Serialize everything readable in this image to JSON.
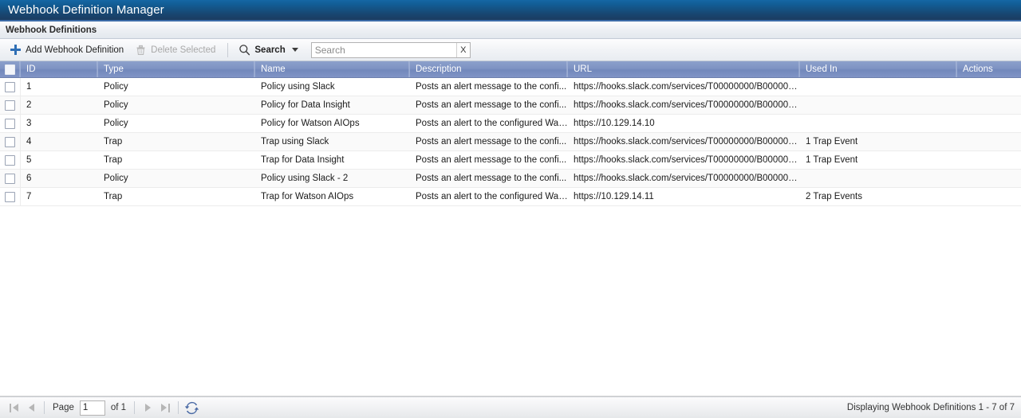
{
  "window": {
    "title": "Webhook Definition Manager"
  },
  "section": {
    "title": "Webhook Definitions"
  },
  "toolbar": {
    "add_label": "Add Webhook Definition",
    "add_icon": "plus-icon",
    "delete_label": "Delete Selected",
    "delete_icon": "trash-icon",
    "search_label": "Search",
    "search_icon": "magnifier-icon",
    "search_caret_icon": "chevron-down-icon",
    "search_value": "",
    "search_placeholder": "Search",
    "search_clear_label": "X"
  },
  "grid": {
    "columns": [
      {
        "key": "checkbox",
        "label": ""
      },
      {
        "key": "id",
        "label": "ID"
      },
      {
        "key": "type",
        "label": "Type"
      },
      {
        "key": "name",
        "label": "Name"
      },
      {
        "key": "description",
        "label": "Description"
      },
      {
        "key": "url",
        "label": "URL"
      },
      {
        "key": "used_in",
        "label": "Used In"
      },
      {
        "key": "actions",
        "label": "Actions"
      }
    ],
    "rows": [
      {
        "id": "1",
        "type": "Policy",
        "name": "Policy using Slack",
        "description": "Posts an alert message to the confi...",
        "url": "https://hooks.slack.com/services/T00000000/B0000000...",
        "used_in": "",
        "actions": ""
      },
      {
        "id": "2",
        "type": "Policy",
        "name": "Policy for Data Insight",
        "description": "Posts an alert message to the confi...",
        "url": "https://hooks.slack.com/services/T00000000/B0000000...",
        "used_in": "",
        "actions": ""
      },
      {
        "id": "3",
        "type": "Policy",
        "name": "Policy for Watson AIOps",
        "description": "Posts an alert to the configured Wat...",
        "url": "https://10.129.14.10",
        "used_in": "",
        "actions": ""
      },
      {
        "id": "4",
        "type": "Trap",
        "name": "Trap using Slack",
        "description": "Posts an alert message to the confi...",
        "url": "https://hooks.slack.com/services/T00000000/B0000000...",
        "used_in": "1 Trap Event",
        "actions": ""
      },
      {
        "id": "5",
        "type": "Trap",
        "name": "Trap for Data Insight",
        "description": "Posts an alert message to the confi...",
        "url": "https://hooks.slack.com/services/T00000000/B0000000...",
        "used_in": "1 Trap Event",
        "actions": ""
      },
      {
        "id": "6",
        "type": "Policy",
        "name": "Policy using Slack - 2",
        "description": "Posts an alert message to the confi...",
        "url": "https://hooks.slack.com/services/T00000000/B0000000...",
        "used_in": "",
        "actions": ""
      },
      {
        "id": "7",
        "type": "Trap",
        "name": "Trap for Watson AIOps",
        "description": "Posts an alert to the configured Wat...",
        "url": "https://10.129.14.11",
        "used_in": "2 Trap Events",
        "actions": ""
      }
    ]
  },
  "pager": {
    "first_icon": "first-page-icon",
    "prev_icon": "previous-page-icon",
    "page_label": "Page",
    "page_value": "1",
    "of_label": "of 1",
    "next_icon": "next-page-icon",
    "last_icon": "last-page-icon",
    "refresh_icon": "refresh-icon",
    "status": "Displaying Webhook Definitions 1 - 7 of 7"
  },
  "colors": {
    "titlebar_blue": "#18456f",
    "titlebar_accent": "#3c6ca8",
    "grid_header_blue": "#7e93c3",
    "plus_blue": "#2f6fb5",
    "refresh_blue": "#4a6aa5",
    "row_alt": "#fafafa"
  }
}
